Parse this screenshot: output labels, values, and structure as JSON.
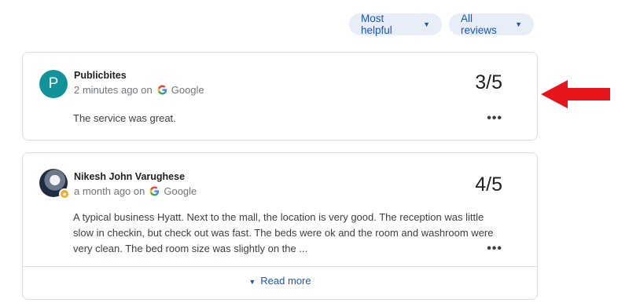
{
  "filters": {
    "sort_label": "Most helpful",
    "filter_label": "All reviews"
  },
  "reviews": [
    {
      "avatar_letter": "P",
      "author": "Publicbites",
      "time": "2 minutes ago on",
      "source": "Google",
      "rating": "3/5",
      "text": "The service was great."
    },
    {
      "author": "Nikesh John Varughese",
      "time": "a month ago on",
      "source": "Google",
      "rating": "4/5",
      "text": "A typical business Hyatt. Next to the mall, the location is very good. The reception was little slow in checkin, but check out was fast. The beds were ok and the room and washroom were very clean. The bed room size was slightly on the ...",
      "read_more": "Read more"
    }
  ],
  "colors": {
    "accent": "#1a56b8",
    "chip_bg": "#e8eef8",
    "avatar_bg": "#12939a",
    "arrow": "#e8141c"
  },
  "icons": {
    "caret": "caret-down-icon",
    "google": "google-g-icon",
    "more": "more-horiz-icon"
  }
}
